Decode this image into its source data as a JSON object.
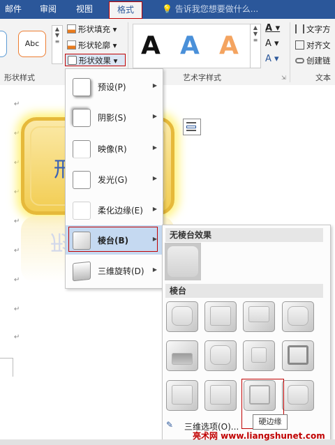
{
  "tabs": [
    "邮件",
    "审阅",
    "视图",
    "格式"
  ],
  "tell_me": "告诉我您想要做什么...",
  "ribbon": {
    "shape_style_sample": "Abc",
    "shape_fill": "形状填充",
    "shape_outline": "形状轮廓",
    "shape_effects": "形状效果",
    "wordart_letters": [
      "A",
      "A",
      "A"
    ],
    "text_direction": "文字方",
    "align_text": "对齐文",
    "create_link": "创建链",
    "group_shape_styles": "形状样式",
    "group_wordart_styles": "艺术字样式",
    "group_text": "文本"
  },
  "document": {
    "shape_text": "形",
    "paragraph_mark": "↵"
  },
  "menu": {
    "items": [
      {
        "label": "预设(P)"
      },
      {
        "label": "阴影(S)"
      },
      {
        "label": "映像(R)"
      },
      {
        "label": "发光(G)"
      },
      {
        "label": "柔化边缘(E)"
      },
      {
        "label": "棱台(B)"
      },
      {
        "label": "三维旋转(D)"
      }
    ]
  },
  "submenu": {
    "no_bevel_header": "无棱台效果",
    "bevel_header": "棱台",
    "tooltip": "硬边缘",
    "options_label": "三维选项(O)..."
  },
  "watermark": "亮术网 www.liangshunet.com",
  "colors": {
    "tab_bar": "#2b579a",
    "highlight_red": "#c00000",
    "hover_blue": "#c5d9f1",
    "shape_gold": "#f2cd52",
    "glow_yellow": "#fff27a",
    "wordart_blue": "#4a90d9",
    "wordart_orange": "#f4a460"
  }
}
